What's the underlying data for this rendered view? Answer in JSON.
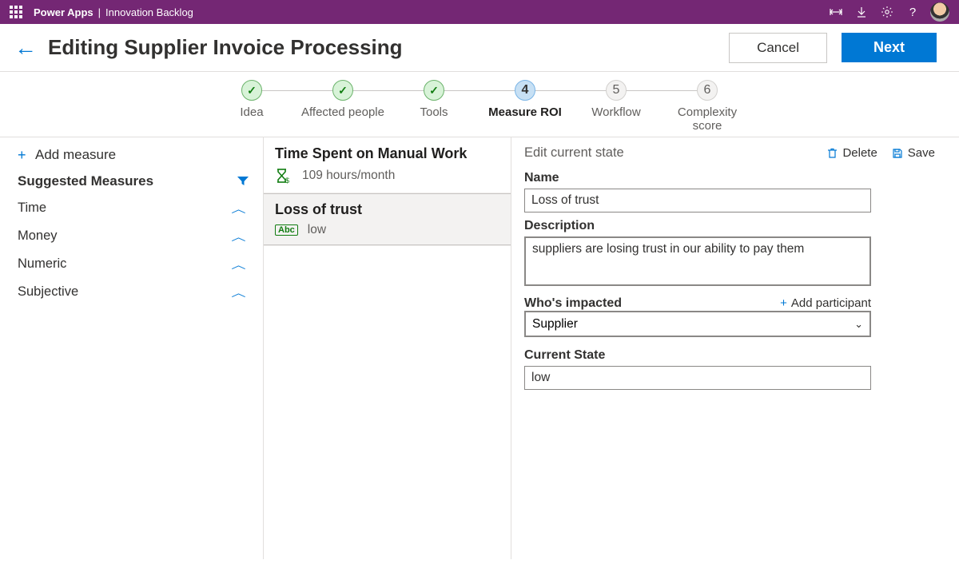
{
  "topbar": {
    "brand": "Power Apps",
    "appname": "Innovation Backlog"
  },
  "header": {
    "title": "Editing Supplier Invoice Processing",
    "cancel": "Cancel",
    "next": "Next"
  },
  "stepper": [
    {
      "label": "Idea",
      "state": "done",
      "indicator": "✓"
    },
    {
      "label": "Affected people",
      "state": "done",
      "indicator": "✓"
    },
    {
      "label": "Tools",
      "state": "done",
      "indicator": "✓"
    },
    {
      "label": "Measure ROI",
      "state": "active",
      "indicator": "4"
    },
    {
      "label": "Workflow",
      "state": "future",
      "indicator": "5"
    },
    {
      "label": "Complexity score",
      "state": "future",
      "indicator": "6"
    }
  ],
  "left": {
    "add_measure": "Add measure",
    "suggested_title": "Suggested Measures",
    "categories": [
      "Time",
      "Money",
      "Numeric",
      "Subjective"
    ]
  },
  "mid": {
    "items": [
      {
        "title": "Time Spent on Manual Work",
        "value": "109 hours/month",
        "icon": "hourglass",
        "selected": false
      },
      {
        "title": "Loss of trust",
        "value": "low",
        "icon": "abc",
        "selected": true
      }
    ]
  },
  "right": {
    "header_label": "Edit current state",
    "delete": "Delete",
    "save": "Save",
    "name_label": "Name",
    "name_value": "Loss of trust",
    "desc_label": "Description",
    "desc_value": "suppliers are losing trust in our ability to pay them",
    "impact_label": "Who's impacted",
    "add_participant": "Add participant",
    "impact_value": "Supplier",
    "state_label": "Current State",
    "state_value": "low"
  }
}
